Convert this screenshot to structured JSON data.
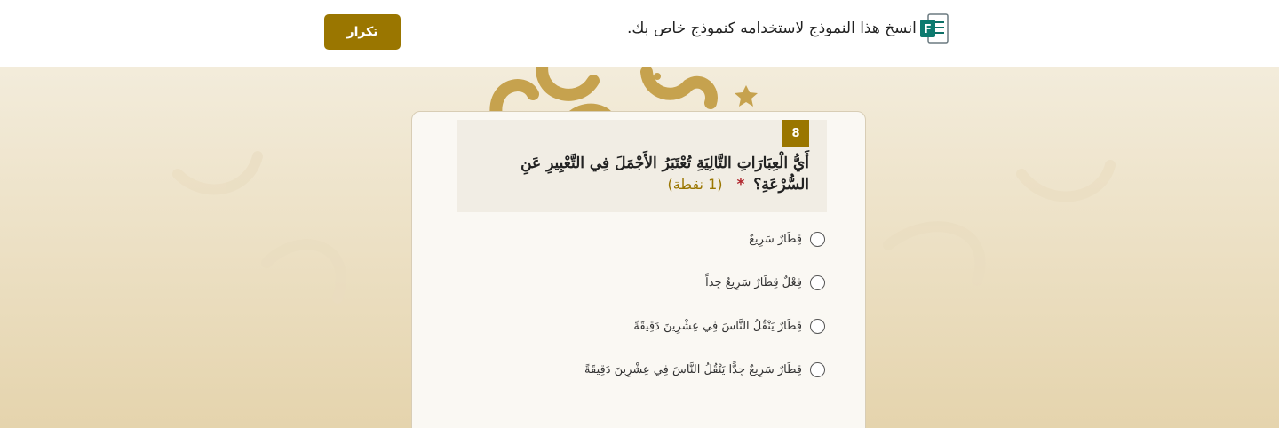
{
  "header": {
    "copy_text": "انسخ هذا النموذج لاستخدامه كنموذج خاص بك.",
    "copy_icon": "microsoft-forms-icon",
    "repeat_label": "تكرار"
  },
  "question": {
    "number": "8",
    "text": "أَيُّ الْعِبَارَاتِ التَّالِيَةِ تُعْتَبَرُ الأَجْمَلَ فِي التَّعْبِيرِ عَنِ السُّرْعَةِ؟",
    "required_mark": "*",
    "points": "(1 نقطة)"
  },
  "options": [
    {
      "label": "قِطَارٌ سَرِيعٌ"
    },
    {
      "label": "فِعْلٌ قِطَارٌ سَرِيعٌ جِداً"
    },
    {
      "label": "قِطَارٌ يَنْقُلُ النَّاسَ فِي عِشْرِينَ دَقِيقَةً"
    },
    {
      "label": "قِطَارٌ سَرِيعٌ جِدًّا يَنْقُلُ النَّاسَ فِي عِشْرِينَ دَقِيقَةً"
    }
  ],
  "colors": {
    "accent": "#9a7600",
    "required": "#b1262d",
    "background_top": "#f3ecdb",
    "background_bottom": "#e5d4ad"
  }
}
